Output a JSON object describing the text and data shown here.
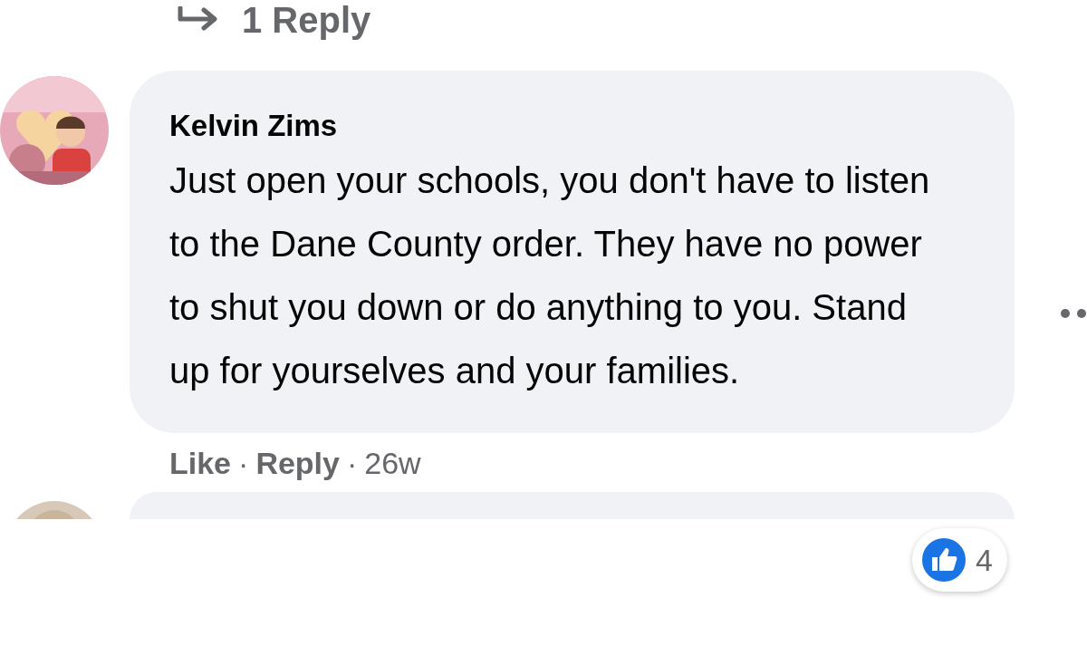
{
  "previous_thread": {
    "replies_link": "1 Reply"
  },
  "comment": {
    "author": "Kelvin Zims",
    "text": "Just open your schools, you don't have to listen to the Dane County order. They have no power to shut you down or do anything to you. Stand up for yourselves and your families.",
    "reactions": {
      "count": "4"
    },
    "actions": [
      {
        "label": "Like"
      },
      {
        "label": "Reply"
      }
    ],
    "separator": "·",
    "timestamp": "26w"
  }
}
